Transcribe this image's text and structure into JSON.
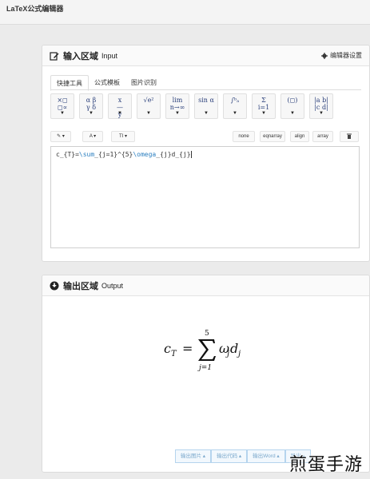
{
  "app": {
    "title": "LaTeX公式编辑器"
  },
  "input_panel": {
    "title": "输入区域",
    "subtitle": "Input",
    "settings_label": "编辑器设置",
    "tabs": [
      "快捷工具",
      "公式模板",
      "图片识别"
    ],
    "active_tab": 0,
    "symbols": [
      {
        "name": "operators",
        "glyph": "×◻\n◻∝"
      },
      {
        "name": "greek",
        "glyph": "α β\nγ δ"
      },
      {
        "name": "fraction",
        "glyph": "x\n—\ny"
      },
      {
        "name": "sqrt",
        "glyph": "√e²"
      },
      {
        "name": "limit",
        "glyph": "lim\nn→∞"
      },
      {
        "name": "trig",
        "glyph": "sin α"
      },
      {
        "name": "integral",
        "glyph": "∫ᵇₐ"
      },
      {
        "name": "sum",
        "glyph": "Σ\ni=1"
      },
      {
        "name": "brackets",
        "glyph": "(◻)"
      },
      {
        "name": "matrix",
        "glyph": "|a b|\n|c d|"
      }
    ],
    "format": {
      "pen": "✎ ▾",
      "font": "A ▾",
      "size": "TI ▾",
      "envs": [
        "none",
        "eqnarray",
        "align",
        "array"
      ],
      "delete": "🗑"
    },
    "editor_value": {
      "black1": "c_{T}=",
      "blue1": "\\sum",
      "black2": "_{j=1}^{5}",
      "blue2": "\\omega",
      "black3": "_{j}d_{j}"
    }
  },
  "output_panel": {
    "title": "输出区域",
    "subtitle": "Output",
    "formula": {
      "lhs": "c",
      "lhs_sub": "T",
      "eq": "=",
      "upper": "5",
      "lower": "j=1",
      "omega": "ω",
      "sub_j": "j",
      "d": "d",
      "sub_j2": "j"
    },
    "export_buttons": [
      "输出图片 ▴",
      "输出代码 ▴",
      "输出Word ▴",
      "导出 ▴"
    ]
  },
  "watermark": "煎蛋手游",
  "colors": {
    "accent": "#2a3f7a",
    "code_blue": "#2b7fc0",
    "button_border": "#b5d4ee"
  }
}
